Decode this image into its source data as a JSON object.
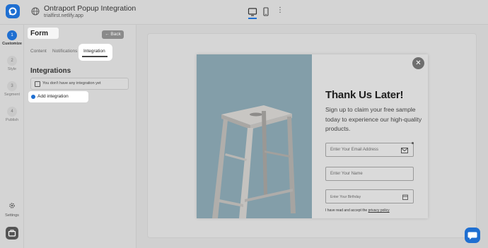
{
  "app": {
    "title": "Ontraport Popup Integration",
    "url": "trialfirst.netlify.app"
  },
  "rail": {
    "steps": [
      {
        "num": "1",
        "label": "Customize",
        "active": true
      },
      {
        "num": "2",
        "label": "Style",
        "active": false
      },
      {
        "num": "3",
        "label": "Segment",
        "active": false
      },
      {
        "num": "4",
        "label": "Publish",
        "active": false
      }
    ],
    "settings_label": "Settings"
  },
  "panel": {
    "title": "Form",
    "back_label": "Back",
    "tabs": [
      "Content",
      "Notifications",
      "Integration"
    ],
    "active_tab": "Integration",
    "section_title": "Integrations",
    "empty_message": "You don't have any integration yet",
    "add_label": "Add integration"
  },
  "popup": {
    "title": "Thank Us Later!",
    "subtitle": "Sign up to claim your free sample today to experience our high-quality products.",
    "email_placeholder": "Enter Your Email Address",
    "name_placeholder": "Enter Your Name",
    "birthday_placeholder": "Enter Your Birthday",
    "consent_text": "I have read and accept the",
    "consent_link": "privacy policy",
    "close_glyph": "✕"
  },
  "colors": {
    "accent": "#1f6fd1",
    "image_bg": "#7f9aa6"
  }
}
